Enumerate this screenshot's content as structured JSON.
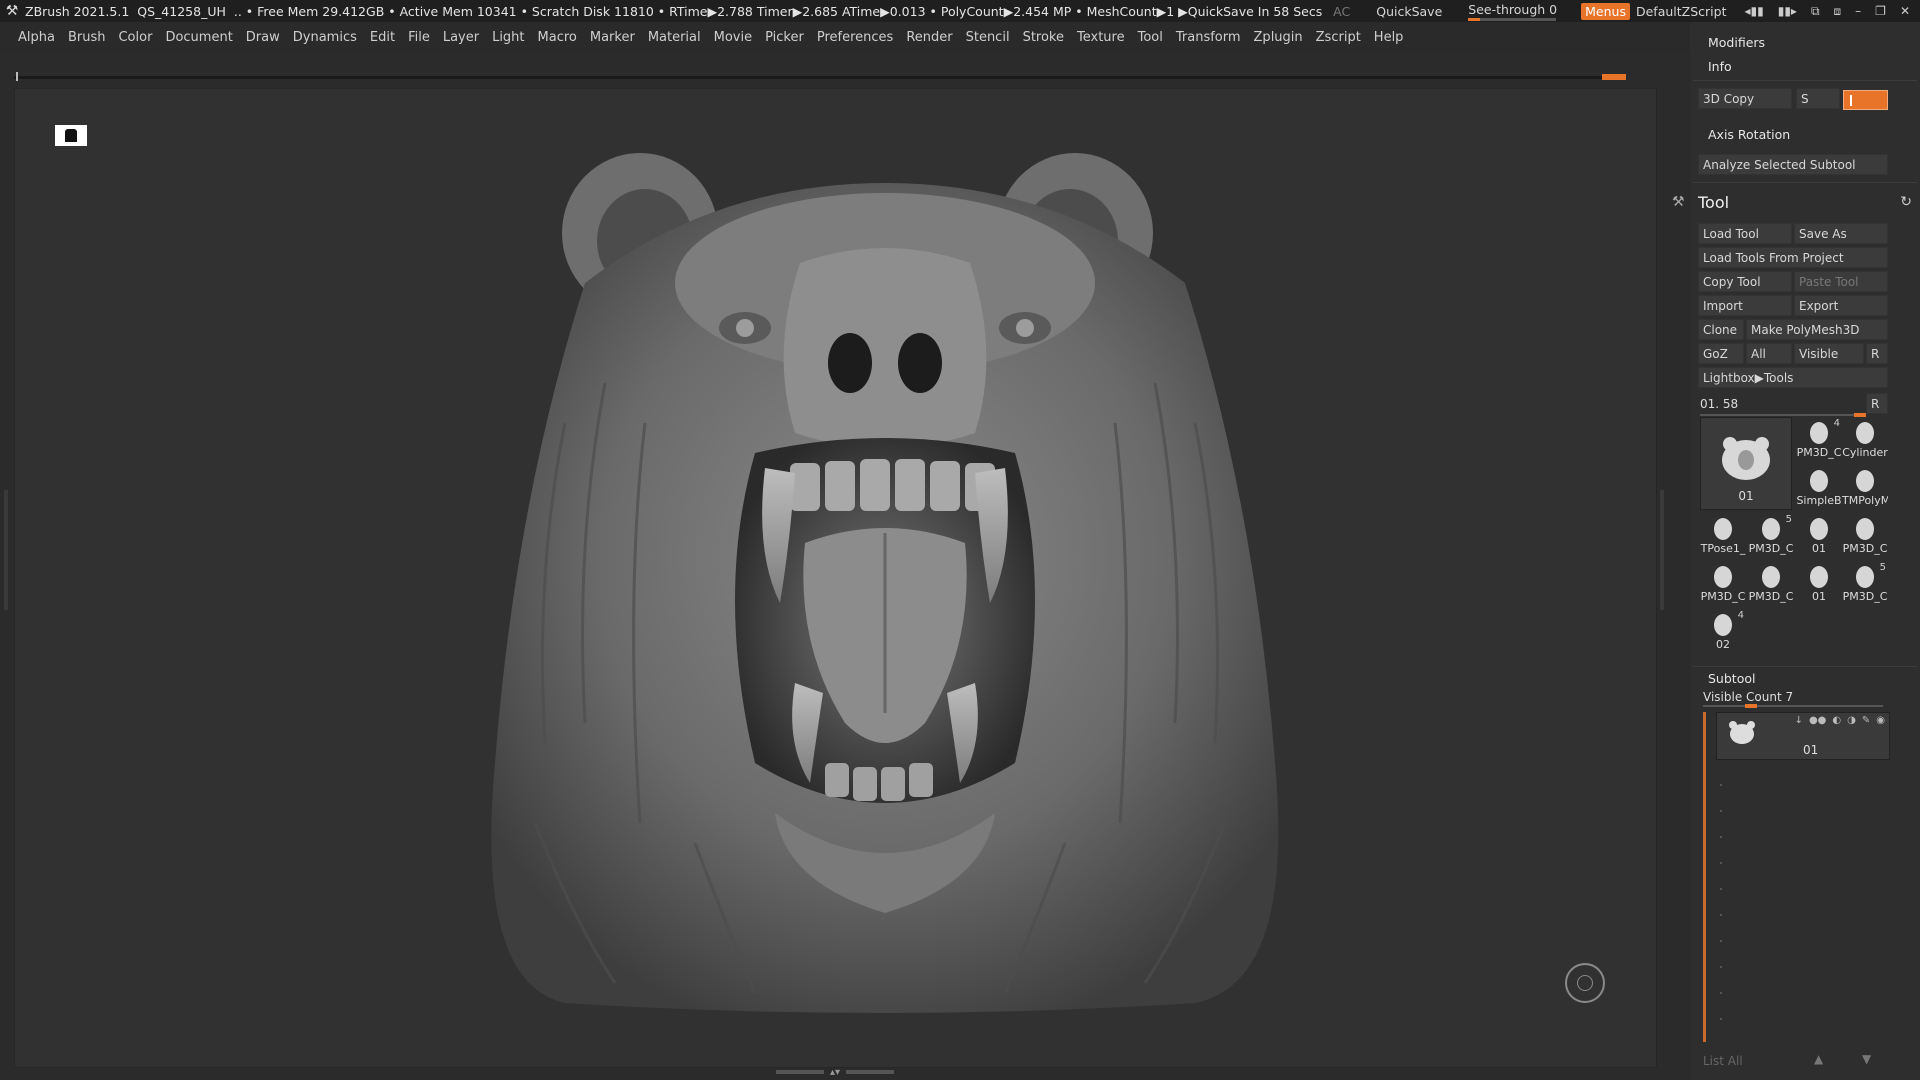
{
  "titlebar": {
    "app": "ZBrush 2021.5.1",
    "doc": "QS_41258_UH",
    "stats": ".. • Free Mem 29.412GB • Active Mem 10341 • Scratch Disk 11810 • RTime▶2.788 Timer▶2.685 ATime▶0.013 • PolyCount▶2.454 MP • MeshCount▶1 ▶QuickSave In 58 Secs",
    "ac": "AC",
    "quicksave": "QuickSave",
    "seethrough": "See-through  0",
    "seethrough_value": 0,
    "menus": "Menus",
    "script": "DefaultZScript"
  },
  "menubar": [
    "Alpha",
    "Brush",
    "Color",
    "Document",
    "Draw",
    "Dynamics",
    "Edit",
    "File",
    "Layer",
    "Light",
    "Macro",
    "Marker",
    "Material",
    "Movie",
    "Picker",
    "Preferences",
    "Render",
    "Stencil",
    "Stroke",
    "Texture",
    "Tool",
    "Transform",
    "Zplugin",
    "Zscript",
    "Help"
  ],
  "panel": {
    "modifiers": "Modifiers",
    "info": "Info",
    "copy3d": "3D Copy",
    "s_label": "S",
    "axis_rotation": "Axis Rotation",
    "analyze": "Analyze Selected Subtool",
    "tool_title": "Tool",
    "load_tool": "Load Tool",
    "save_as": "Save As",
    "load_from_project": "Load Tools From Project",
    "copy_tool": "Copy Tool",
    "paste_tool": "Paste Tool",
    "import": "Import",
    "export": "Export",
    "clone": "Clone",
    "make_polymesh": "Make PolyMesh3D",
    "goz": "GoZ",
    "all": "All",
    "visible": "Visible",
    "r": "R",
    "lightbox": "Lightbox▶Tools",
    "slider_label": "01. 58",
    "big_thumb_label": "01",
    "thumbs": [
      {
        "cap": "PM3D_C",
        "num": "4"
      },
      {
        "cap": "Cylinder",
        "num": ""
      },
      {
        "cap": "SimpleB",
        "num": ""
      },
      {
        "cap": "TMPolyM",
        "num": ""
      },
      {
        "cap": "TPose1_",
        "num": ""
      },
      {
        "cap": "PM3D_C",
        "num": "5"
      },
      {
        "cap": "01",
        "num": ""
      },
      {
        "cap": "PM3D_C",
        "num": ""
      },
      {
        "cap": "PM3D_C",
        "num": ""
      },
      {
        "cap": "PM3D_C",
        "num": ""
      },
      {
        "cap": "01",
        "num": ""
      },
      {
        "cap": "PM3D_C",
        "num": "5"
      },
      {
        "cap": "02",
        "num": "4"
      }
    ],
    "subtool_title": "Subtool",
    "visible_count": "Visible Count 7",
    "subtool_name": "01",
    "list_all": "List All"
  },
  "colors": {
    "accent": "#e8742a",
    "background": "#2b2b2b",
    "canvas": "#313131",
    "panel": "#2e2e2e"
  }
}
